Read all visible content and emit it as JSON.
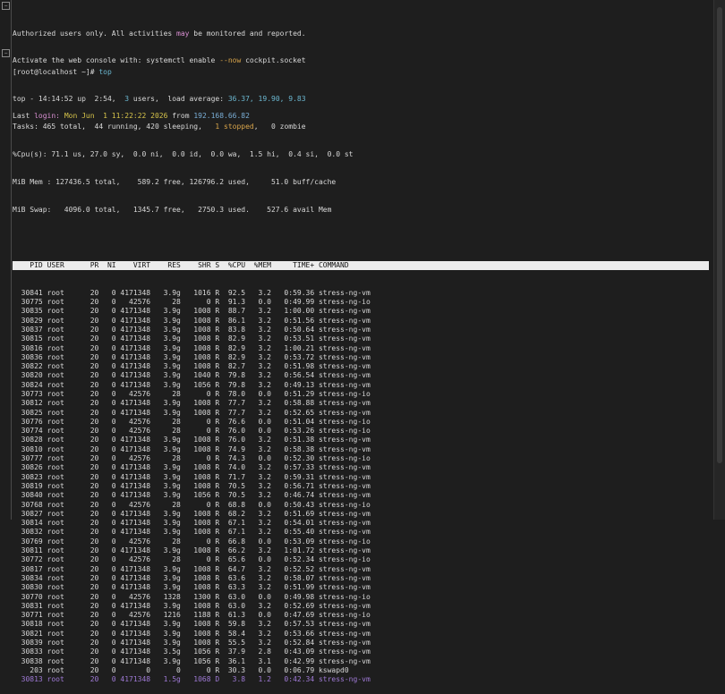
{
  "banner": {
    "line1_a": "Authorized users only. All activities ",
    "line1_b": "may",
    "line1_c": " be monitored and reported.",
    "line2_a": "Activate the web console with: systemctl enable ",
    "line2_b": "--now",
    "line2_c": " cockpit.socket",
    "last_label": "Last ",
    "last_login": "login:",
    "last_date": " Mon Jun  1 11:22:22 2026",
    "last_from": " from ",
    "last_ip": "192.168.66.82"
  },
  "prompt": {
    "text": "[root@localhost ~]# ",
    "cmd": "top"
  },
  "summary": {
    "l1_a": "top - 14:14:52 up  2:54,  ",
    "l1_b": "3",
    "l1_c": " users,  load average: ",
    "l1_d": "36.37, 19.90, 9.83",
    "l2_a": "Tasks: 465 total,  44 running, 420 sleeping,   ",
    "l2_b": "1 stopped",
    "l2_c": ",   0 zombie",
    "l3": "%Cpu(s): 71.1 us, 27.0 sy,  0.0 ni,  0.0 id,  0.0 wa,  1.5 hi,  0.4 si,  0.0 st",
    "l4": "MiB Mem : 127436.5 total,    589.2 free, 126796.2 used,     51.0 buff/cache",
    "l5": "MiB Swap:   4096.0 total,   1345.7 free,   2750.3 used.    527.6 avail Mem"
  },
  "table_header": "    PID USER      PR  NI    VIRT    RES    SHR S  %CPU  %MEM     TIME+ COMMAND",
  "rows": [
    "  30841 root      20   0 4171348   3.9g   1016 R  92.5   3.2   0:59.36 stress-ng-vm",
    "  30775 root      20   0   42576     28      0 R  91.3   0.0   0:49.99 stress-ng-io",
    "  30835 root      20   0 4171348   3.9g   1008 R  88.7   3.2   1:00.00 stress-ng-vm",
    "  30829 root      20   0 4171348   3.9g   1008 R  86.1   3.2   0:51.56 stress-ng-vm",
    "  30837 root      20   0 4171348   3.9g   1008 R  83.8   3.2   0:50.64 stress-ng-vm",
    "  30815 root      20   0 4171348   3.9g   1008 R  82.9   3.2   0:53.51 stress-ng-vm",
    "  30816 root      20   0 4171348   3.9g   1008 R  82.9   3.2   1:00.21 stress-ng-vm",
    "  30836 root      20   0 4171348   3.9g   1008 R  82.9   3.2   0:53.72 stress-ng-vm",
    "  30822 root      20   0 4171348   3.9g   1008 R  82.7   3.2   0:51.98 stress-ng-vm",
    "  30820 root      20   0 4171348   3.9g   1040 R  79.8   3.2   0:56.54 stress-ng-vm",
    "  30824 root      20   0 4171348   3.9g   1056 R  79.8   3.2   0:49.13 stress-ng-vm",
    "  30773 root      20   0   42576     28      0 R  78.0   0.0   0:51.29 stress-ng-io",
    "  30812 root      20   0 4171348   3.9g   1008 R  77.7   3.2   0:58.88 stress-ng-vm",
    "  30825 root      20   0 4171348   3.9g   1008 R  77.7   3.2   0:52.65 stress-ng-vm",
    "  30776 root      20   0   42576     28      0 R  76.6   0.0   0:51.04 stress-ng-io",
    "  30774 root      20   0   42576     28      0 R  76.0   0.0   0:53.26 stress-ng-io",
    "  30828 root      20   0 4171348   3.9g   1008 R  76.0   3.2   0:51.38 stress-ng-vm",
    "  30810 root      20   0 4171348   3.9g   1008 R  74.9   3.2   0:58.38 stress-ng-vm",
    "  30777 root      20   0   42576     28      0 R  74.3   0.0   0:52.30 stress-ng-io",
    "  30826 root      20   0 4171348   3.9g   1008 R  74.0   3.2   0:57.33 stress-ng-vm",
    "  30823 root      20   0 4171348   3.9g   1008 R  71.7   3.2   0:59.31 stress-ng-vm",
    "  30819 root      20   0 4171348   3.9g   1008 R  70.5   3.2   0:56.71 stress-ng-vm",
    "  30840 root      20   0 4171348   3.9g   1056 R  70.5   3.2   0:46.74 stress-ng-vm",
    "  30768 root      20   0   42576     28      0 R  68.8   0.0   0:50.43 stress-ng-io",
    "  30827 root      20   0 4171348   3.9g   1008 R  68.2   3.2   0:51.69 stress-ng-vm",
    "  30814 root      20   0 4171348   3.9g   1008 R  67.1   3.2   0:54.01 stress-ng-vm",
    "  30832 root      20   0 4171348   3.9g   1008 R  67.1   3.2   0:55.40 stress-ng-vm",
    "  30769 root      20   0   42576     28      0 R  66.8   0.0   0:53.09 stress-ng-io",
    "  30811 root      20   0 4171348   3.9g   1008 R  66.2   3.2   1:01.72 stress-ng-vm",
    "  30772 root      20   0   42576     28      0 R  65.6   0.0   0:52.34 stress-ng-io",
    "  30817 root      20   0 4171348   3.9g   1008 R  64.7   3.2   0:52.52 stress-ng-vm",
    "  30834 root      20   0 4171348   3.9g   1008 R  63.6   3.2   0:58.07 stress-ng-vm",
    "  30830 root      20   0 4171348   3.9g   1008 R  63.3   3.2   0:51.99 stress-ng-vm",
    "  30770 root      20   0   42576   1328   1300 R  63.0   0.0   0:49.98 stress-ng-io",
    "  30831 root      20   0 4171348   3.9g   1008 R  63.0   3.2   0:52.69 stress-ng-vm",
    "  30771 root      20   0   42576   1216   1188 R  61.3   0.0   0:47.69 stress-ng-io",
    "  30818 root      20   0 4171348   3.9g   1008 R  59.8   3.2   0:57.53 stress-ng-vm",
    "  30821 root      20   0 4171348   3.9g   1008 R  58.4   3.2   0:53.66 stress-ng-vm",
    "  30839 root      20   0 4171348   3.9g   1008 R  55.5   3.2   0:52.84 stress-ng-vm",
    "  30833 root      20   0 4171348   3.5g   1056 R  37.9   2.8   0:43.09 stress-ng-vm",
    "  30838 root      20   0 4171348   3.9g   1056 R  36.1   3.1   0:42.99 stress-ng-vm",
    "    203 root      20   0       0      0      0 R  30.3   0.0   0:06.79 kswapd0",
    "  30813 root      20   0 4171348   1.5g   1068 D   3.8   1.2   0:42.34 stress-ng-vm"
  ],
  "colors": {
    "accent_pink": "#d98fd2",
    "accent_orange": "#d8a44a",
    "accent_blue": "#7aaed6"
  }
}
